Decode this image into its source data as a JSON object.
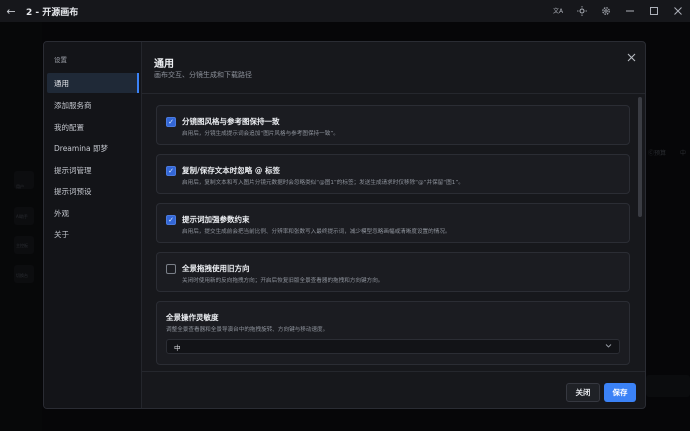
{
  "window": {
    "title": "2 - 开源画布",
    "back_icon": "arrow-left-icon",
    "controls": [
      "translate-icon",
      "sun-icon",
      "gear-icon",
      "minimize-icon",
      "maximize-icon",
      "close-icon"
    ]
  },
  "background": {
    "tools": [
      "用户",
      "AI助手",
      "主控板",
      "切换台"
    ],
    "right_tabs": [
      "Ⓒ预算",
      "中"
    ]
  },
  "settings": {
    "sidebar_title": "设置",
    "nav": [
      {
        "label": "通用",
        "active": true
      },
      {
        "label": "添加服务商",
        "active": false
      },
      {
        "label": "我的配置",
        "active": false
      },
      {
        "label": "Dreamina 即梦",
        "active": false
      },
      {
        "label": "提示词管理",
        "active": false
      },
      {
        "label": "提示词预设",
        "active": false
      },
      {
        "label": "外观",
        "active": false
      },
      {
        "label": "关于",
        "active": false
      }
    ],
    "title": "通用",
    "subtitle": "画布交互、分镜生成和下载路径",
    "options": [
      {
        "title": "分镜图风格与参考图保持一致",
        "desc": "启用后，分镜生成提示词会追加“图片风格与参考图保持一致”。",
        "checked": true
      },
      {
        "title": "复制/保存文本时忽略 @ 标签",
        "desc": "启用后，复制文本和写入图片分镜元数据时会忽略类似“@图1”的标签；发送生成请求时仅移除“@”并保留“图1”。",
        "checked": true
      },
      {
        "title": "提示词加强参数约束",
        "desc": "启用后，提交生成前会把当前比例、分辨率和张数写入最终提示词，减少模型忽略画幅或清晰度设置的情况。",
        "checked": true
      },
      {
        "title": "全景拖拽使用旧方向",
        "desc": "关闭时使用新的反向拖拽方向；开启后恢复旧版全景查看器的拖拽和方向键方向。",
        "checked": false
      }
    ],
    "sensitivity": {
      "title": "全景操作灵敏度",
      "desc": "调整全景查看器和全景导演台中的拖拽旋转、方向键与移动速度。",
      "value": "中"
    },
    "close_label": "关闭",
    "save_label": "保存",
    "accent": "#3b82f6"
  }
}
